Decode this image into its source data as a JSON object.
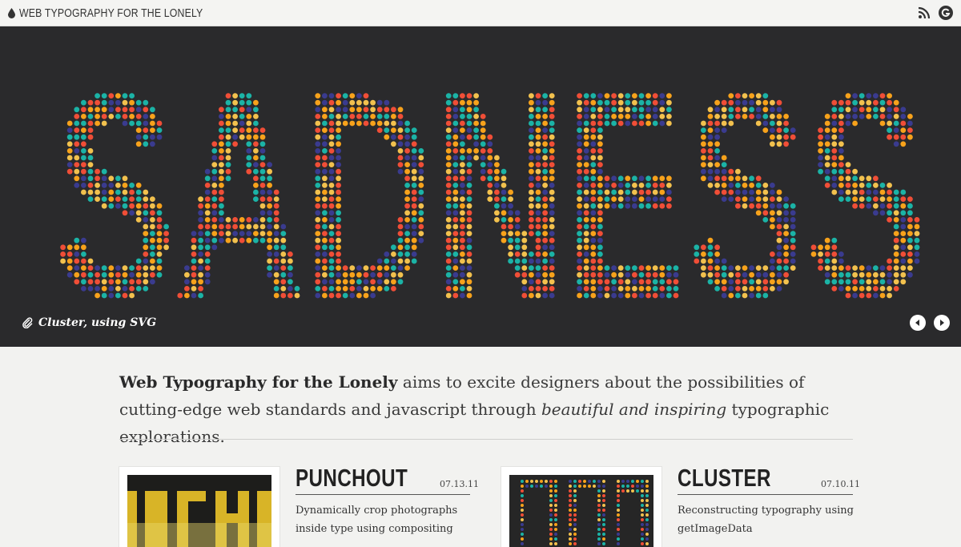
{
  "header": {
    "site_title": "WEB TYPOGRAPHY FOR THE LONELY",
    "icons": [
      "drop-icon",
      "rss-icon",
      "google-plus-icon"
    ]
  },
  "hero": {
    "word": "SADNESS",
    "caption": "Cluster, using SVG",
    "dot_colors": [
      "#f04e37",
      "#f7a21b",
      "#1bb3a6",
      "#3a3b8f",
      "#f2c14e"
    ],
    "background": "#2a2a2c"
  },
  "intro": {
    "site_name": "Web Typography for the Lonely",
    "text_1": " aims to excite designers about the possibilities of cutting-edge web standards and javascript through ",
    "emphasis": "beautiful and inspiring",
    "text_2": " typographic explorations."
  },
  "posts": [
    {
      "title": "PUNCHOUT",
      "date": "07.13.11",
      "description": "Dynamically crop photographs inside type using compositing"
    },
    {
      "title": "CLUSTER",
      "date": "07.10.11",
      "description": "Reconstructing typography using getImageData"
    }
  ]
}
